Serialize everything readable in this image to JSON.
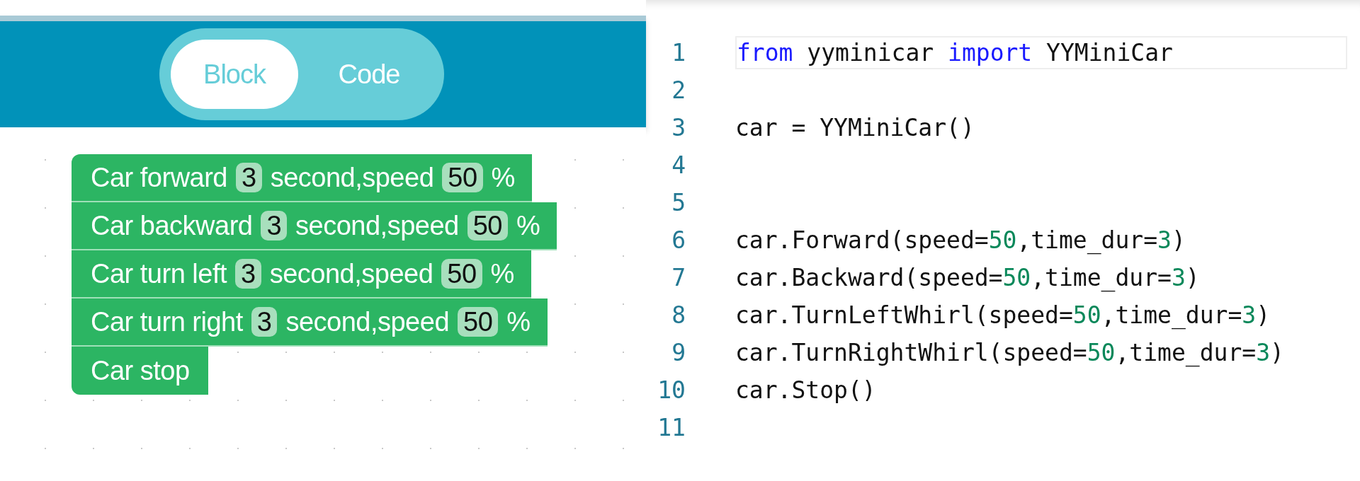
{
  "mode_toggle": {
    "tabs": [
      {
        "label": "Block",
        "selected": true
      },
      {
        "label": "Code",
        "selected": false
      }
    ]
  },
  "blocks": [
    {
      "kind": "timed",
      "label": "Car forward",
      "seconds": "3",
      "middle": "second,speed",
      "speed": "50",
      "unit": "%"
    },
    {
      "kind": "timed",
      "label": "Car backward",
      "seconds": "3",
      "middle": "second,speed",
      "speed": "50",
      "unit": "%"
    },
    {
      "kind": "timed",
      "label": "Car turn left",
      "seconds": "3",
      "middle": "second,speed",
      "speed": "50",
      "unit": "%"
    },
    {
      "kind": "timed",
      "label": "Car turn right",
      "seconds": "3",
      "middle": "second,speed",
      "speed": "50",
      "unit": "%"
    },
    {
      "kind": "plain",
      "label": "Car stop"
    }
  ],
  "code": {
    "lines": [
      {
        "number": "1",
        "tokens": [
          {
            "kind": "keyword",
            "text": "from"
          },
          {
            "kind": "plain",
            "text": " yyminicar "
          },
          {
            "kind": "keyword",
            "text": "import"
          },
          {
            "kind": "plain",
            "text": " YYMiniCar"
          }
        ]
      },
      {
        "number": "2"
      },
      {
        "number": "3",
        "tokens": [
          {
            "kind": "plain",
            "text": "car = YYMiniCar()"
          }
        ]
      },
      {
        "number": "4"
      },
      {
        "number": "5"
      },
      {
        "number": "6",
        "tokens": [
          {
            "kind": "plain",
            "text": "car.Forward(speed="
          },
          {
            "kind": "number",
            "text": "50"
          },
          {
            "kind": "plain",
            "text": ",time_dur="
          },
          {
            "kind": "number",
            "text": "3"
          },
          {
            "kind": "plain",
            "text": ")"
          }
        ]
      },
      {
        "number": "7",
        "tokens": [
          {
            "kind": "plain",
            "text": "car.Backward(speed="
          },
          {
            "kind": "number",
            "text": "50"
          },
          {
            "kind": "plain",
            "text": ",time_dur="
          },
          {
            "kind": "number",
            "text": "3"
          },
          {
            "kind": "plain",
            "text": ")"
          }
        ]
      },
      {
        "number": "8",
        "tokens": [
          {
            "kind": "plain",
            "text": "car.TurnLeftWhirl(speed="
          },
          {
            "kind": "number",
            "text": "50"
          },
          {
            "kind": "plain",
            "text": ",time_dur="
          },
          {
            "kind": "number",
            "text": "3"
          },
          {
            "kind": "plain",
            "text": ")"
          }
        ]
      },
      {
        "number": "9",
        "tokens": [
          {
            "kind": "plain",
            "text": "car.TurnRightWhirl(speed="
          },
          {
            "kind": "number",
            "text": "50"
          },
          {
            "kind": "plain",
            "text": ",time_dur="
          },
          {
            "kind": "number",
            "text": "3"
          },
          {
            "kind": "plain",
            "text": ")"
          }
        ]
      },
      {
        "number": "10",
        "tokens": [
          {
            "kind": "plain",
            "text": "car.Stop()"
          }
        ]
      },
      {
        "number": "11"
      }
    ]
  }
}
